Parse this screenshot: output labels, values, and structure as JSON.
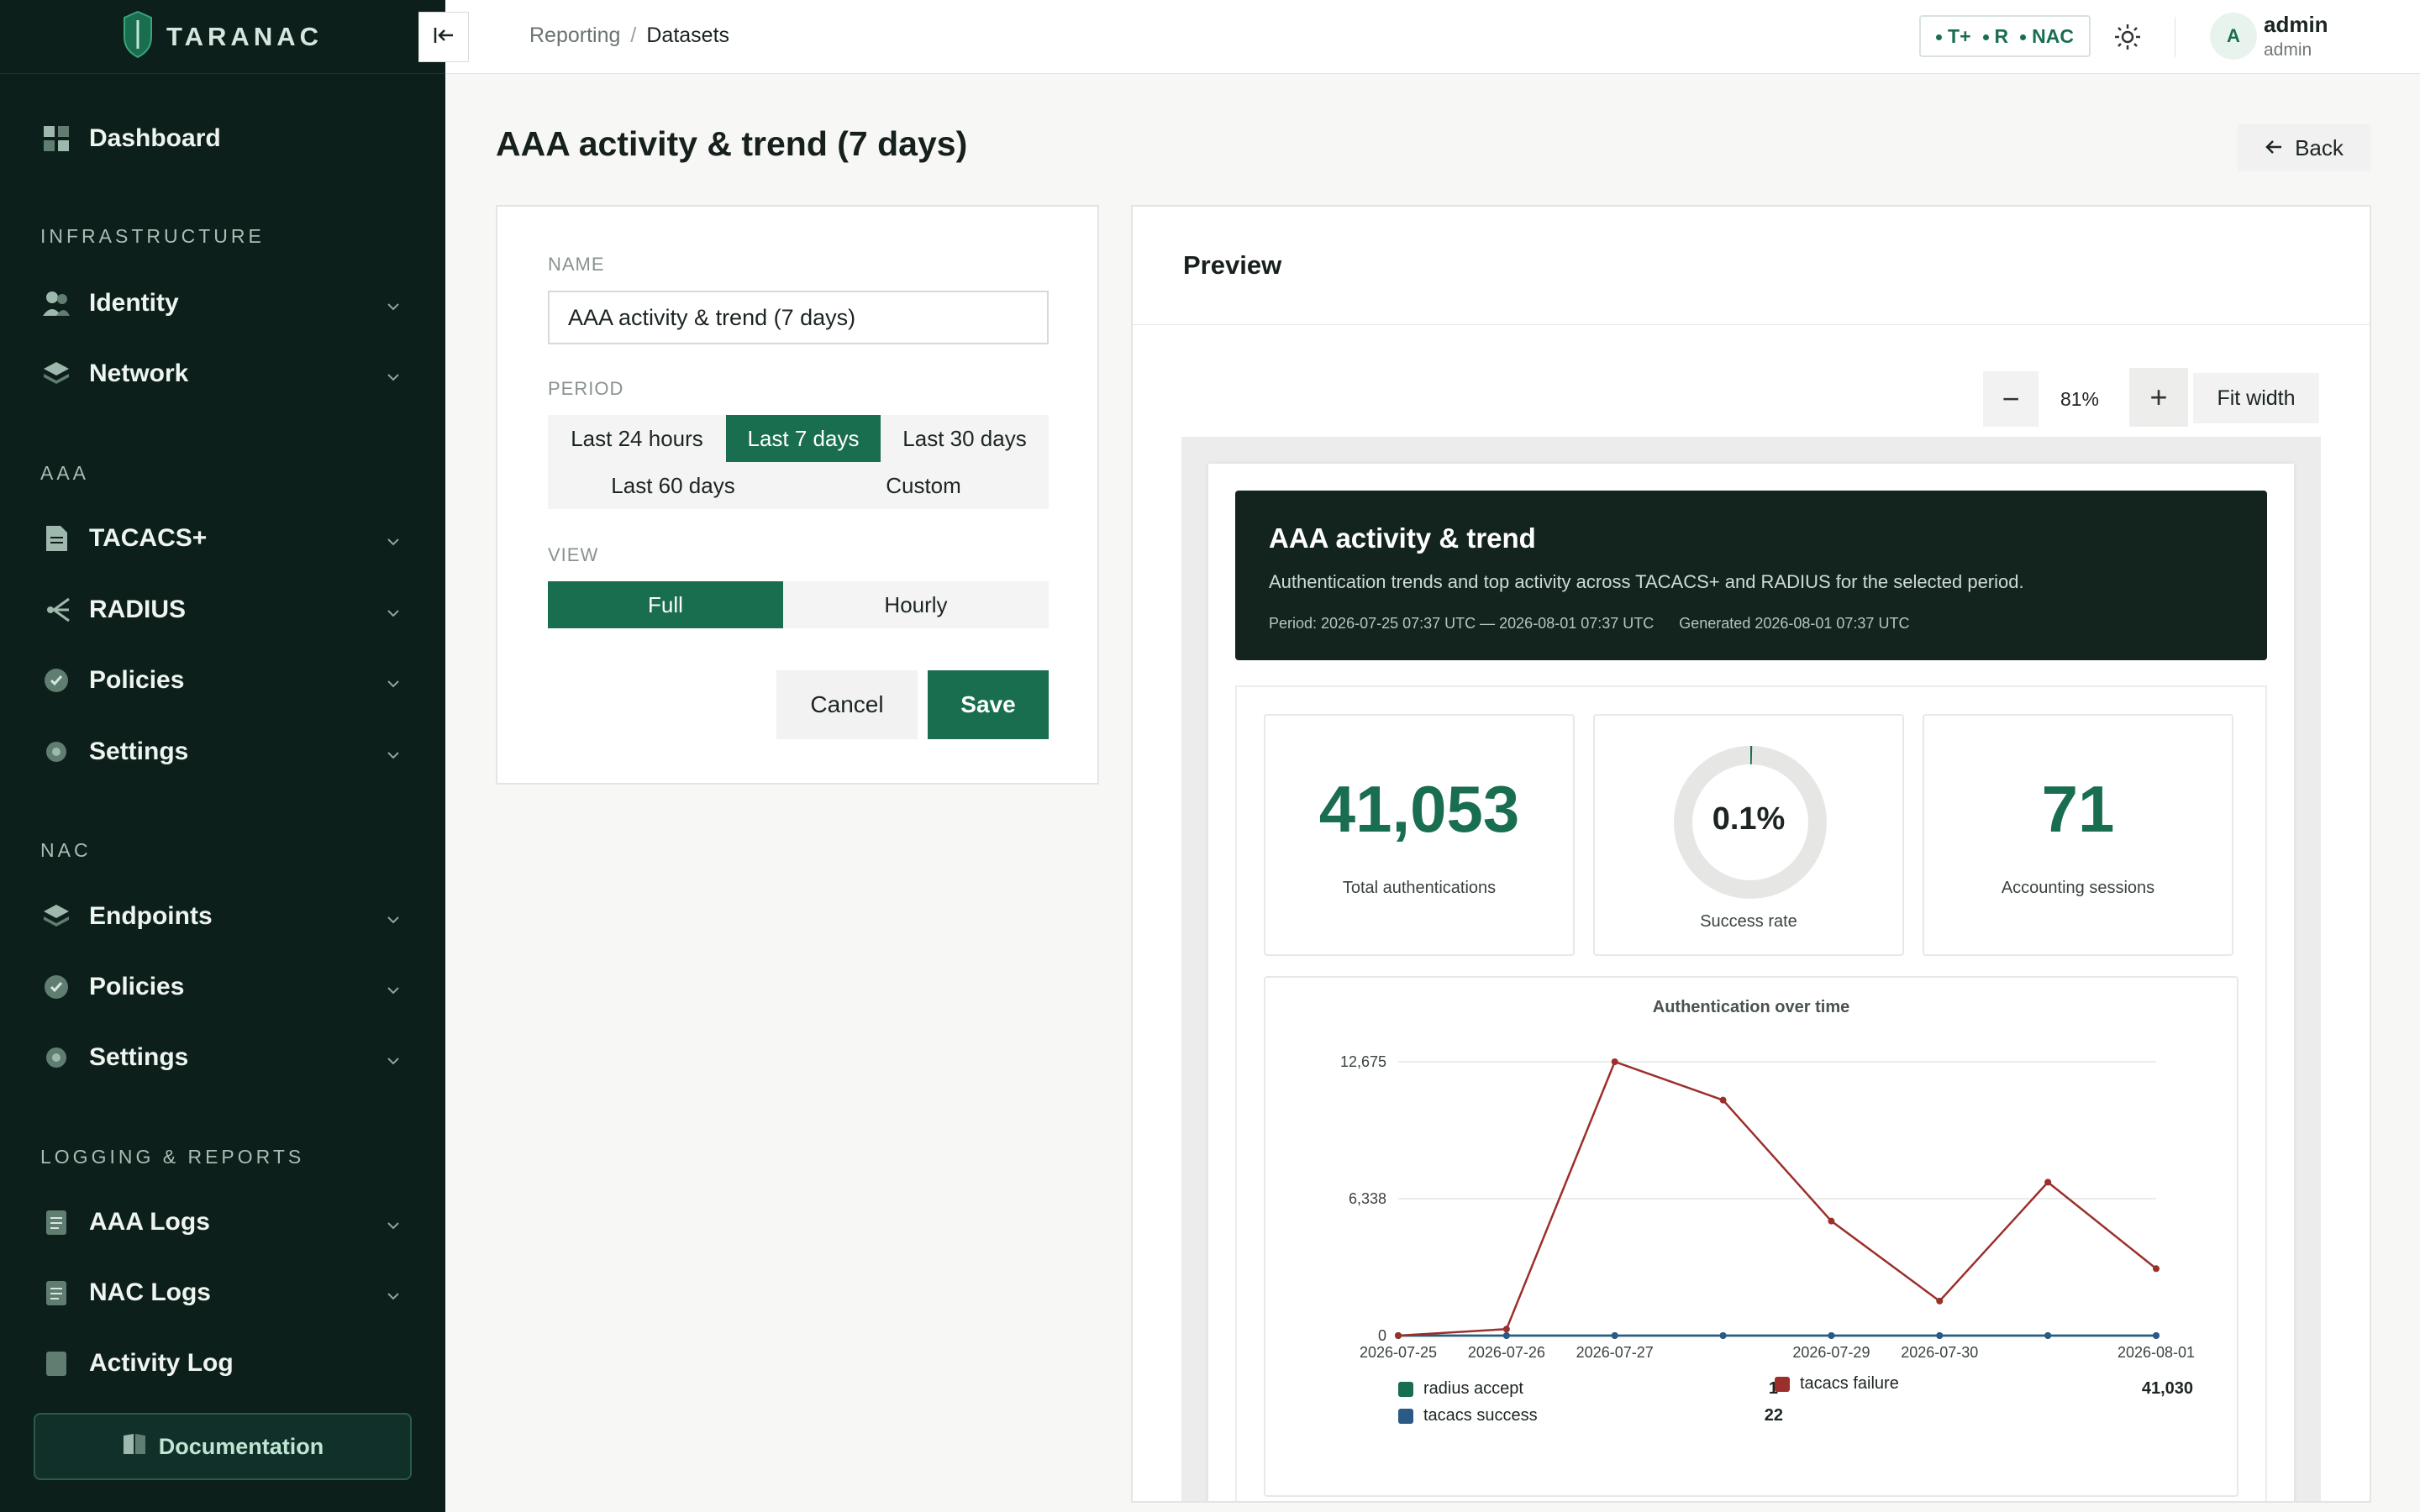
{
  "brand": {
    "name": "TARANAC"
  },
  "sidebar": {
    "dashboard": "Dashboard",
    "sections": {
      "infrastructure": "INFRASTRUCTURE",
      "aaa": "AAA",
      "nac": "NAC",
      "logging": "LOGGING & REPORTS"
    },
    "items": {
      "identity": "Identity",
      "network": "Network",
      "tacacs": "TACACS+",
      "radius": "RADIUS",
      "aaa_policies": "Policies",
      "aaa_settings": "Settings",
      "endpoints": "Endpoints",
      "nac_policies": "Policies",
      "nac_settings": "Settings",
      "aaa_logs": "AAA Logs",
      "nac_logs": "NAC Logs",
      "activity_log": "Activity Log"
    },
    "documentation": "Documentation"
  },
  "topbar": {
    "breadcrumb": [
      "Reporting",
      "Datasets"
    ],
    "breadcrumb_sep": "/",
    "protocols": [
      "T+",
      "R",
      "NAC"
    ],
    "user": {
      "initial": "A",
      "name": "admin",
      "role": "admin"
    }
  },
  "page": {
    "title": "AAA activity & trend (7 days)",
    "back_label": "Back"
  },
  "form": {
    "name_label": "NAME",
    "name_value": "AAA activity & trend (7 days)",
    "period_label": "PERIOD",
    "period_options": [
      "Last 24 hours",
      "Last 7 days",
      "Last 30 days",
      "Last 60 days",
      "Custom"
    ],
    "period_selected": "Last 7 days",
    "view_label": "VIEW",
    "view_options": [
      "Full",
      "Hourly"
    ],
    "view_selected": "Full",
    "cancel_label": "Cancel",
    "save_label": "Save"
  },
  "preview": {
    "title": "Preview",
    "zoom": "81%",
    "zoom_out": "−",
    "zoom_in": "+",
    "fit_width": "Fit width",
    "report": {
      "title": "AAA activity & trend",
      "description": "Authentication trends and top activity across TACACS+ and RADIUS for the selected period.",
      "period": "Period: 2026-07-25 07:37 UTC — 2026-08-01 07:37 UTC",
      "generated": "Generated 2026-08-01 07:37 UTC",
      "kpis": {
        "total_auth": {
          "value": "41,053",
          "label": "Total authentications"
        },
        "success_rate": {
          "value": "0.1%",
          "label": "Success rate",
          "fraction": 0.001
        },
        "accounting": {
          "value": "71",
          "label": "Accounting sessions"
        }
      },
      "legend": [
        {
          "name": "radius accept",
          "value": "1",
          "color": "#1a6e50"
        },
        {
          "name": "tacacs failure",
          "value": "41,030",
          "color": "#9b2f2b"
        },
        {
          "name": "tacacs success",
          "value": "22",
          "color": "#2b5a86"
        }
      ]
    }
  },
  "colors": {
    "accent": "#1a6e50",
    "sidebar_bg": "#0d1f1a",
    "failure": "#9b2f2b",
    "success_line": "#2b5a86"
  },
  "chart_data": {
    "type": "line",
    "title": "Authentication over time",
    "x": [
      "2026-07-25",
      "2026-07-26",
      "2026-07-27",
      "2026-07-28",
      "2026-07-29",
      "2026-07-30",
      "2026-07-31",
      "2026-08-01"
    ],
    "x_tick_labels": [
      "2026-07-25",
      "2026-07-26",
      "2026-07-27",
      "2026-07-29",
      "2026-07-30",
      "2026-08-01"
    ],
    "y_ticks": [
      "12,675",
      "6,338",
      "0"
    ],
    "ylim": [
      0,
      12675
    ],
    "grid": true,
    "series": [
      {
        "name": "tacacs failure",
        "color": "#9b2f2b",
        "values": [
          0,
          300,
          12675,
          10900,
          5300,
          1600,
          7100,
          3100
        ]
      },
      {
        "name": "tacacs success",
        "color": "#2b5a86",
        "values": [
          0,
          0,
          0,
          0,
          0,
          0,
          0,
          0
        ]
      },
      {
        "name": "radius accept",
        "color": "#1a6e50",
        "values": [
          0,
          0,
          0,
          0,
          0,
          0,
          0,
          0
        ]
      }
    ]
  }
}
